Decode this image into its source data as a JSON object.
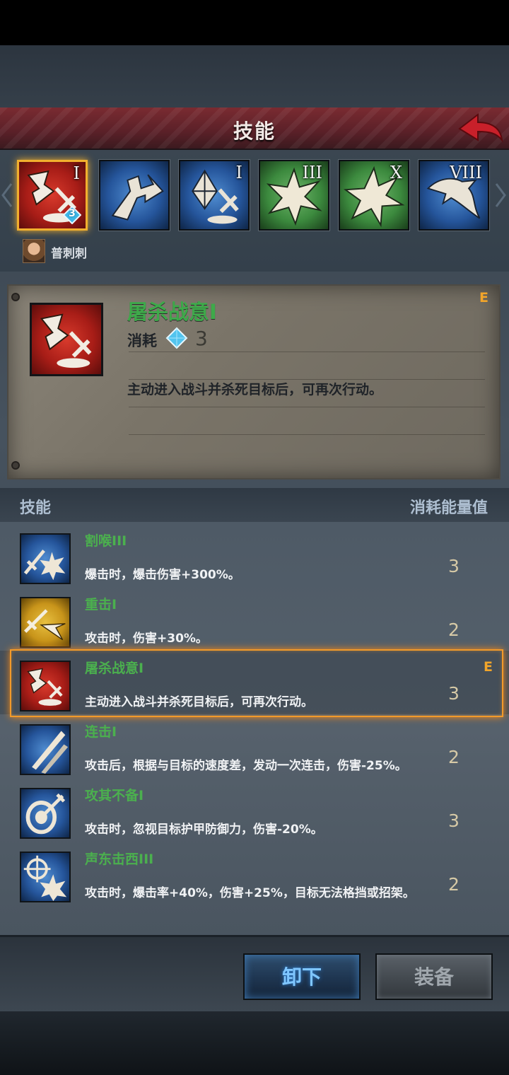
{
  "header": {
    "title": "技能"
  },
  "skill_slots": [
    {
      "level": "I",
      "color": "red",
      "icon": "slaughter-sword-icon",
      "gem": "3"
    },
    {
      "level": "",
      "color": "blue",
      "icon": "charge-arrow-icon"
    },
    {
      "level": "I",
      "color": "blue",
      "icon": "crystal-sword-icon"
    },
    {
      "level": "III",
      "color": "green",
      "icon": "burst-star-icon"
    },
    {
      "level": "X",
      "color": "green",
      "icon": "burst-star-icon"
    },
    {
      "level": "VIII",
      "color": "blue",
      "icon": "winged-dash-icon"
    }
  ],
  "hero": {
    "name": "普刺刺"
  },
  "detail": {
    "name": "屠杀战意I",
    "cost_label": "消耗",
    "cost_value": "3",
    "description": "主动进入战斗并杀死目标后，可再次行动。",
    "rank": "E"
  },
  "list_header": {
    "skill": "技能",
    "cost": "消耗能量值"
  },
  "skills": [
    {
      "name": "割喉III",
      "desc": "爆击时，爆击伤害+300%。",
      "cost": "3",
      "color": "blue",
      "icon": "sword-burst-icon"
    },
    {
      "name": "重击I",
      "desc": "攻击时，伤害+30%。",
      "cost": "2",
      "color": "gold",
      "icon": "sword-arrow-icon"
    },
    {
      "name": "屠杀战意I",
      "desc": "主动进入战斗并杀死目标后，可再次行动。",
      "cost": "3",
      "color": "red",
      "icon": "slaughter-sword-icon",
      "rank": "E"
    },
    {
      "name": "连击I",
      "desc": "攻击后，根据与目标的速度差，发动一次连击，伤害-25%。",
      "cost": "2",
      "color": "blue",
      "icon": "double-blade-icon"
    },
    {
      "name": "攻其不备I",
      "desc": "攻击时，忽视目标护甲防御力，伤害-20%。",
      "cost": "3",
      "color": "blue",
      "icon": "shield-pierce-icon"
    },
    {
      "name": "声东击西III",
      "desc": "攻击时，爆击率+40%，伤害+25%，目标无法格挡或招架。",
      "cost": "2",
      "color": "blue",
      "icon": "target-burst-icon"
    }
  ],
  "buttons": {
    "unequip": "卸下",
    "equip": "装备"
  },
  "colors": {
    "accent_orange": "#f29a2a",
    "skill_name_green": "#4bb04e",
    "header_red": "#7a2b31"
  }
}
